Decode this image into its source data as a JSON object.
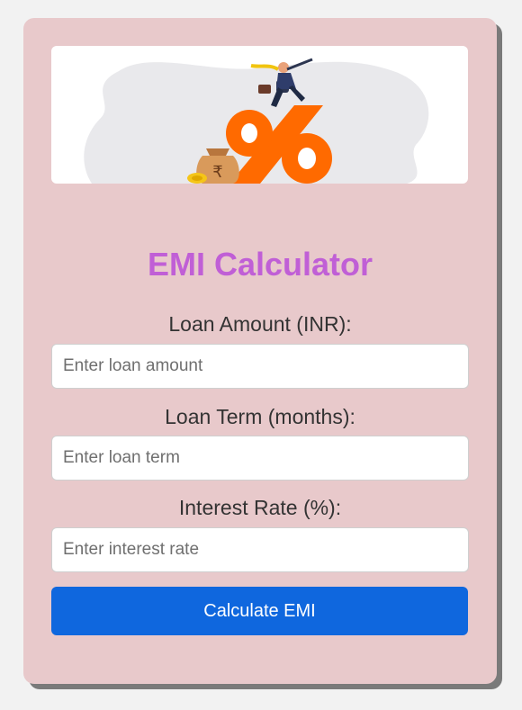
{
  "title": "EMI Calculator",
  "banner": {
    "illustration": "businessman-on-percent-sign-with-rupee-money-bag",
    "currency_symbol": "₹"
  },
  "fields": [
    {
      "label": "Loan Amount (INR):",
      "placeholder": "Enter loan amount",
      "value": ""
    },
    {
      "label": "Loan Term (months):",
      "placeholder": "Enter loan term",
      "value": ""
    },
    {
      "label": "Interest Rate (%):",
      "placeholder": "Enter interest rate",
      "value": ""
    }
  ],
  "button": {
    "label": "Calculate EMI"
  },
  "colors": {
    "page_bg": "#f2f2f2",
    "card_bg": "#e8c9cb",
    "title": "#c05fd6",
    "button": "#0f67de",
    "percent_orange": "#ff6a00"
  }
}
